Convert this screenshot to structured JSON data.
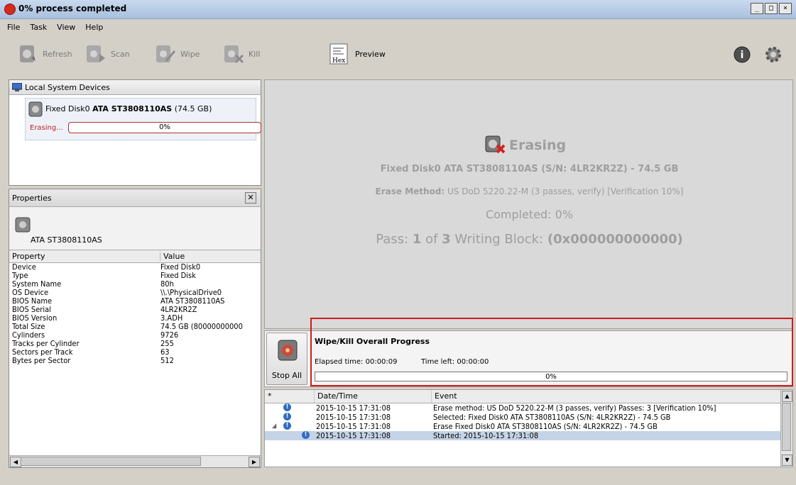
{
  "window": {
    "title": "0% process completed",
    "minimize": "_",
    "maximize": "□",
    "close": "×"
  },
  "menu": [
    "File",
    "Task",
    "View",
    "Help"
  ],
  "toolbar": {
    "refresh": "Refresh",
    "scan": "Scan",
    "wipe": "Wipe",
    "kill": "Kill",
    "preview": "Preview",
    "hex_label": "Hex"
  },
  "devices": {
    "header": "Local System Devices",
    "item": {
      "prefix": "Fixed Disk0 ",
      "model": "ATA ST3808110AS",
      "size": " (74.5 GB)",
      "status": "Erasing...",
      "progress_text": "0%",
      "progress": 0
    }
  },
  "properties": {
    "header": "Properties",
    "device_label": "ATA    ST3808110AS",
    "col_property": "Property",
    "col_value": "Value",
    "rows": [
      {
        "k": "Device",
        "v": "Fixed Disk0"
      },
      {
        "k": "Type",
        "v": "Fixed Disk"
      },
      {
        "k": "System Name",
        "v": "80h"
      },
      {
        "k": "OS Device",
        "v": "\\\\.\\PhysicalDrive0"
      },
      {
        "k": "BIOS Name",
        "v": "ATA    ST3808110AS"
      },
      {
        "k": "BIOS Serial",
        "v": "4LR2KR2Z"
      },
      {
        "k": "BIOS Version",
        "v": "3.ADH"
      },
      {
        "k": "Total Size",
        "v": "74.5 GB (80000000000"
      },
      {
        "k": "Cylinders",
        "v": "9726"
      },
      {
        "k": "Tracks per Cylinder",
        "v": "255"
      },
      {
        "k": "Sectors per Track",
        "v": "63"
      },
      {
        "k": "Bytes per Sector",
        "v": "512"
      }
    ]
  },
  "main": {
    "title": "Erasing",
    "disk_line": "Fixed Disk0 ATA ST3808110AS (S/N: 4LR2KR2Z) - 74.5 GB",
    "method_label": "Erase Method:",
    "method_value": " US DoD 5220.22-M (3 passes, verify) [Verification 10%]",
    "completed": "Completed: 0%",
    "pass_prefix": "Pass: ",
    "pass_num": "1",
    "pass_of": " of ",
    "pass_total": "3",
    "block_label": " Writing Block: ",
    "block_value": "(0x000000000000)"
  },
  "overall": {
    "stop_label": "Stop All",
    "title": "Wipe/Kill Overall Progress",
    "elapsed": "Elapsed time: 00:00:09",
    "left": "Time left: 00:00:00",
    "progress_text": "0%",
    "progress": 0
  },
  "log": {
    "col_star": "*",
    "col_date": "Date/Time",
    "col_event": "Event",
    "rows": [
      {
        "dt": "2015-10-15 17:31:08",
        "ev": "Erase method: US DoD 5220.22-M (3 passes, verify) Passes: 3 [Verification 10%]"
      },
      {
        "dt": "2015-10-15 17:31:08",
        "ev": "Selected: Fixed Disk0 ATA    ST3808110AS (S/N: 4LR2KR2Z) - 74.5 GB"
      },
      {
        "dt": "2015-10-15 17:31:08",
        "ev": "Erase Fixed Disk0 ATA    ST3808110AS (S/N: 4LR2KR2Z) - 74.5 GB"
      },
      {
        "dt": "2015-10-15 17:31:08",
        "ev": "Started: 2015-10-15 17:31:08"
      }
    ]
  }
}
